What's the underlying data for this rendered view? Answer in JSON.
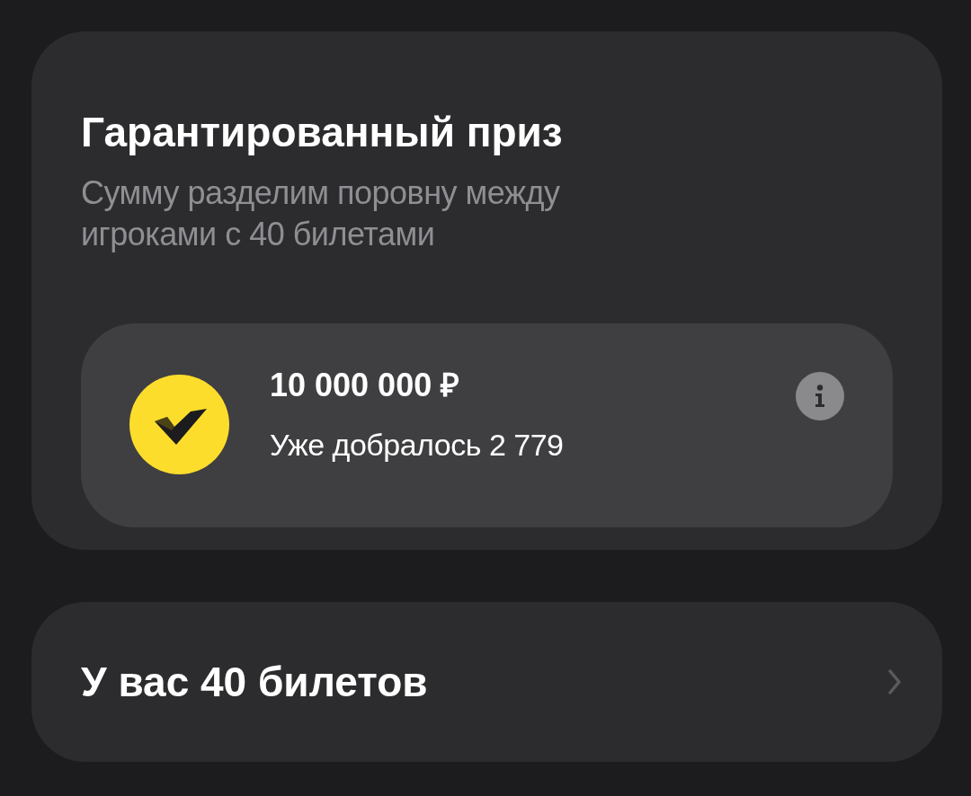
{
  "prize_card": {
    "title": "Гарантированный приз",
    "subtitle": "Сумму разделим поровну между игроками с 40 билетами",
    "prize": {
      "amount": "10 000 000 ₽",
      "reached": "Уже добралось 2 779"
    }
  },
  "tickets_card": {
    "title": "У вас 40 билетов"
  }
}
